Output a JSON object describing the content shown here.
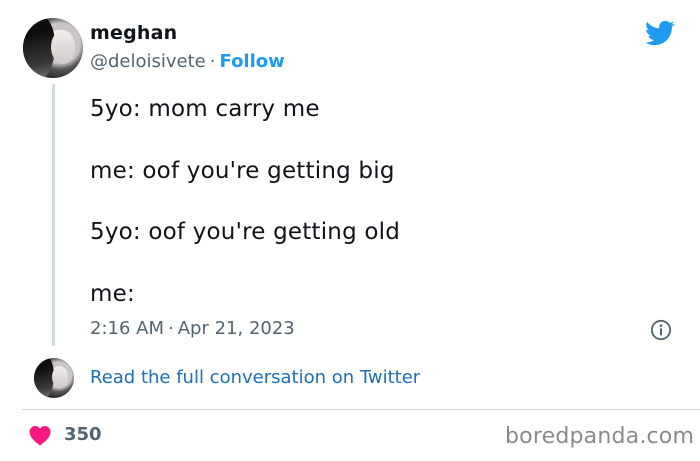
{
  "tweet": {
    "display_name": "meghan",
    "handle": "@deloisivete",
    "separator": "·",
    "follow_label": "Follow",
    "lines": [
      "5yo: mom carry me",
      "me: oof you're getting big",
      "5yo: oof you're getting old",
      "me:"
    ],
    "time": "2:16 AM",
    "date": "Apr 21, 2023",
    "read_link": "Read the full conversation on Twitter",
    "like_count": "350"
  },
  "icons": {
    "brand": "twitter-bird-icon",
    "info": "info-icon",
    "like": "heart-icon"
  },
  "colors": {
    "twitter_blue": "#1d9bf0",
    "heart": "#f91880",
    "secondary_text": "#536471"
  },
  "watermark": "boredpanda.com"
}
